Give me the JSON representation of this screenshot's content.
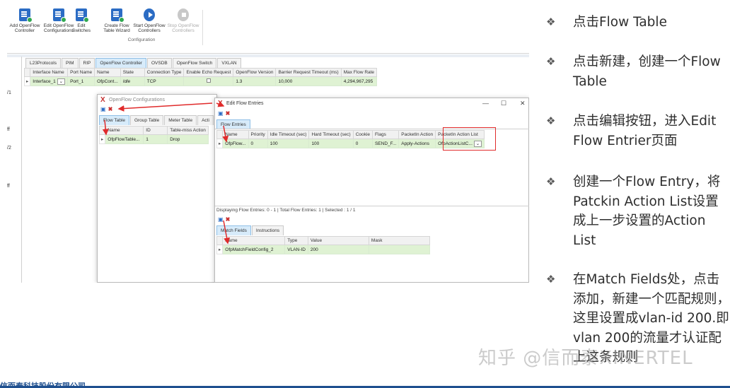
{
  "ribbon": {
    "buttons": [
      {
        "label": "Add OpenFlow Controller"
      },
      {
        "label": "Edit OpenFlow Configurations"
      },
      {
        "label": "Edit Switches"
      },
      {
        "label": "Create Flow Table Wizard"
      },
      {
        "label": "Start OpenFlow Controllers"
      },
      {
        "label": "Stop OpenFlow Controllers"
      }
    ],
    "group_label": "Configuration"
  },
  "main_tabs": [
    "L23Protocols",
    "PIM",
    "RIP",
    "OpenFlow Controller",
    "OVSDB",
    "OpenFlow Switch",
    "VXLAN"
  ],
  "controller_table": {
    "headers": [
      "Interface Name",
      "Port Name",
      "Name",
      "State",
      "Connection Type",
      "Enable Echo Request",
      "OpenFlow Version",
      "Barrier Request Timeout (ms)",
      "Max Flow Rate"
    ],
    "row": [
      "Interface_1",
      "Port_1",
      "OfpCont...",
      "Idle",
      "TCP",
      "",
      "1.3",
      "10,000",
      "4,294,967,295"
    ]
  },
  "side_labels": [
    "/1",
    "ff",
    "/2",
    "ff"
  ],
  "config_window": {
    "title": "OpenFlow Configurations",
    "tabs": [
      "Flow Table",
      "Group Table",
      "Meter Table",
      "Acti"
    ],
    "headers": [
      "Name",
      "ID",
      "Table-miss Action"
    ],
    "row": [
      "OfpFlowTable...",
      "1",
      "Drop"
    ]
  },
  "flow_window": {
    "title": "Edit Flow Entries",
    "controls": {
      "minimize": "—",
      "maximize": "☐",
      "close": "✕"
    },
    "tab": "Flow Entries",
    "headers": [
      "Name",
      "Priority",
      "Idle Timeout (sec)",
      "Hard Timeout (sec)",
      "Cookie",
      "Flags",
      "PacketIn Action",
      "PacketIn Action List"
    ],
    "row": [
      "OfpFlow...",
      "0",
      "100",
      "100",
      "0",
      "SEND_F...",
      "Apply-Actions",
      "OfpActionListC..."
    ],
    "status": "Displaying Flow Entries: 0 - 1 | Total Flow Entries: 1 | Selected : 1 / 1",
    "lower_tabs": [
      "Match Fields",
      "Instructions"
    ],
    "match_headers": [
      "Name",
      "Type",
      "Value",
      "Mask"
    ],
    "match_row": [
      "OfpMatchFieldConfig_2",
      "VLAN-ID",
      "200",
      ""
    ]
  },
  "notes": [
    {
      "text": "点击Flow Table"
    },
    {
      "text": "点击新建，创建一个Flow Table"
    },
    {
      "text": "点击编辑按钮，进入Edit Flow Entrier页面"
    },
    {
      "text": "创建一个Flow  Entry，将Patckin Action List设置成上一步设置的Action List"
    },
    {
      "text": "在Match Fields处，点击添加，新建一个匹配规则，这里设置成vlan-id 200.即 vlan 200的流量才认证配上这条规则"
    }
  ],
  "bullet": "❖",
  "watermark": "知乎 @信而泰XINERTEL",
  "footer_text": "信而泰科技股份有限公司",
  "colors": {
    "accent_blue": "#2b6cc4",
    "row_green": "#dff2d3",
    "highlight_red": "#e02b2b",
    "footer_blue": "#1e4f8f"
  }
}
